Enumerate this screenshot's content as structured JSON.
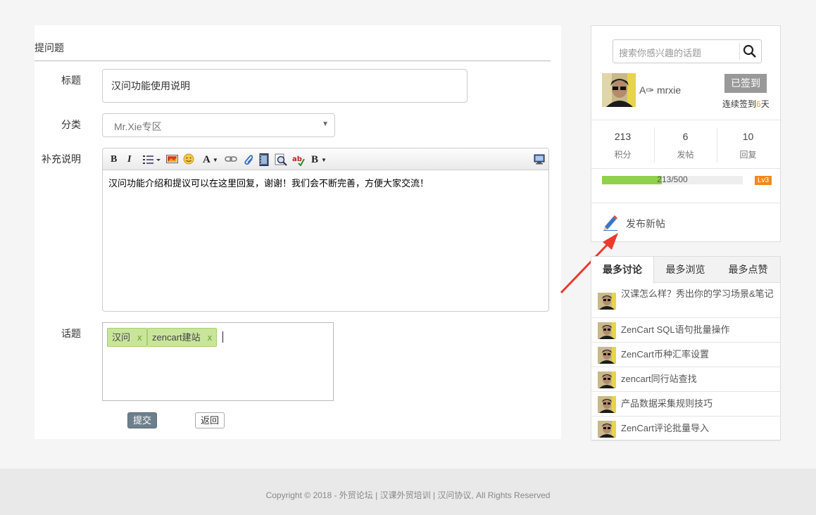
{
  "form": {
    "heading": "提问题",
    "title_label": "标题",
    "title_value": "汉问功能使用说明",
    "category_label": "分类",
    "category_value": "Mr.Xie专区",
    "desc_label": "补充说明",
    "desc_content": "汉问功能介绍和提议可以在这里回复，谢谢！我们会不断完善，方便大家交流！",
    "topic_label": "话题",
    "tags": [
      {
        "label": "汉问",
        "remove": "x"
      },
      {
        "label": "zencart建站",
        "remove": "x"
      }
    ],
    "submit_label": "提交",
    "back_label": "返回",
    "toolbar_icons": [
      "bold-icon",
      "italic-icon",
      "ordered-list-icon",
      "image-icon",
      "emoji-icon",
      "font-color-icon",
      "link-icon",
      "attachment-icon",
      "video-icon",
      "preview-icon",
      "spellcheck-icon",
      "block-format-icon",
      "source-view-icon"
    ],
    "toolbar_text": {
      "bold": "B",
      "italic": "I",
      "font": "A",
      "format": "B"
    }
  },
  "sidebar": {
    "search_placeholder": "搜索你感兴趣的话题",
    "username": "A✑ mrxie",
    "signed_label": "已签到",
    "streak_prefix": "连续签到",
    "streak_days": "6",
    "streak_suffix": "天",
    "stats": [
      {
        "value": "213",
        "label": "积分"
      },
      {
        "value": "6",
        "label": "发帖"
      },
      {
        "value": "10",
        "label": "回复"
      }
    ],
    "progress_text": "213/500",
    "progress_fraction": 0.426,
    "level": "Lv3",
    "new_post_label": "发布新帖",
    "level_color": "#f08a1c",
    "progress_color": "#8fd14a"
  },
  "tabs": {
    "items": [
      "最多讨论",
      "最多浏览",
      "最多点赞"
    ],
    "active": 0,
    "list": [
      "汉课怎么样？秀出你的学习场景&笔记",
      "ZenCart SQL语句批量操作",
      "ZenCart币种汇率设置",
      "zencart同行站查找",
      "产品数据采集规则技巧",
      "ZenCart评论批量导入"
    ]
  },
  "footer": {
    "text": "Copyright © 2018 - 外贸论坛 | 汉课外贸培训 | 汉问协议, All Rights Reserved"
  },
  "colors": {
    "arrow": "#ec3a2e",
    "submit_bg": "#6e7f8c",
    "tag_bg": "#c9e59c"
  }
}
